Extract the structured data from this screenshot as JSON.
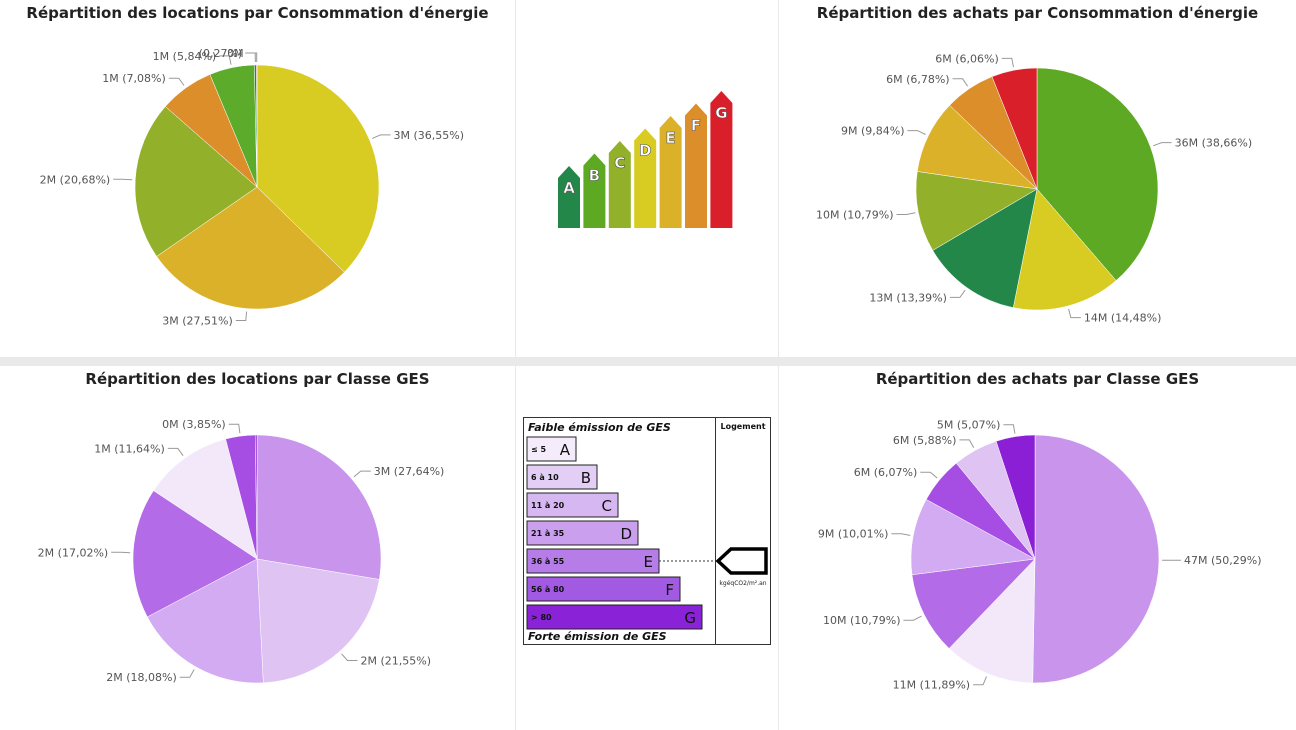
{
  "chart_data": [
    {
      "id": "tl",
      "type": "pie",
      "title": "Répartition des locations par Consommation d'énergie",
      "values": [
        36.55,
        27.51,
        20.68,
        7.08,
        5.84,
        0.27,
        0.07
      ],
      "labels": [
        "3M (36,55%)",
        "3M (27,51%)",
        "2M (20,68%)",
        "1M (7,08%)",
        "1M (5,84%)",
        "(0,27%)",
        "0M"
      ],
      "colors": [
        "#d8cc22",
        "#dcb12a",
        "#93b02a",
        "#db8e2a",
        "#5dab2a",
        "#24874a",
        "#d9202a"
      ]
    },
    {
      "id": "tr",
      "type": "pie",
      "title": "Répartition des achats par Consommation d'énergie",
      "values": [
        38.66,
        14.48,
        13.39,
        10.79,
        9.84,
        6.78,
        6.06
      ],
      "labels": [
        "36M (38,66%)",
        "14M (14,48%)",
        "13M (13,39%)",
        "10M (10,79%)",
        "9M (9,84%)",
        "6M (6,78%)",
        "6M (6,06%)"
      ],
      "colors": [
        "#5ea924",
        "#d8cc22",
        "#24874a",
        "#93b02a",
        "#dcb12a",
        "#db8e2a",
        "#d9202a"
      ]
    },
    {
      "id": "bl",
      "type": "pie",
      "title": "Répartition des locations par Classe GES",
      "values": [
        27.64,
        21.55,
        18.08,
        17.02,
        11.64,
        3.85,
        0.22
      ],
      "labels": [
        "3M (27,64%)",
        "2M (21,55%)",
        "2M (18,08%)",
        "2M (17,02%)",
        "1M (11,64%)",
        "0M (3,85%)",
        ""
      ],
      "colors": [
        "#c995ec",
        "#dfc3f3",
        "#d2abf2",
        "#b36be8",
        "#f2e8fa",
        "#a64ee4",
        "#8a1fd6"
      ]
    },
    {
      "id": "br",
      "type": "pie",
      "title": "Répartition des achats par Classe GES",
      "values": [
        50.29,
        11.89,
        10.79,
        10.01,
        6.07,
        5.88,
        5.07
      ],
      "labels": [
        "47M (50,29%)",
        "11M (11,89%)",
        "10M (10,79%)",
        "9M (10,01%)",
        "6M (6,07%)",
        "6M (5,88%)",
        "5M (5,07%)"
      ],
      "colors": [
        "#c995ec",
        "#f2e8fa",
        "#b36be8",
        "#d2abf2",
        "#a64ee4",
        "#dfc3f3",
        "#8a1fd6"
      ]
    }
  ],
  "energy_scale": {
    "letters": [
      "A",
      "B",
      "C",
      "D",
      "E",
      "F",
      "G"
    ],
    "colors": [
      "#24874a",
      "#5ea924",
      "#93b02a",
      "#d8cc22",
      "#dcb12a",
      "#db8e2a",
      "#d9202a"
    ]
  },
  "ges_label": {
    "top_text": "Faible émission de GES",
    "bottom_text": "Forte émission de GES",
    "column_header": "Logement",
    "unit": "kgéqCO2/m².an",
    "rows": [
      {
        "range": "≤ 5",
        "letter": "A",
        "color": "#f4ecfb"
      },
      {
        "range": "6 à 10",
        "letter": "B",
        "color": "#e3cff5"
      },
      {
        "range": "11 à 20",
        "letter": "C",
        "color": "#d6b7f1"
      },
      {
        "range": "21 à 35",
        "letter": "D",
        "color": "#c99fee"
      },
      {
        "range": "36 à 55",
        "letter": "E",
        "color": "#b67ce8"
      },
      {
        "range": "56 à 80",
        "letter": "F",
        "color": "#a35ae2"
      },
      {
        "range": "> 80",
        "letter": "G",
        "color": "#8a22d8"
      }
    ]
  }
}
